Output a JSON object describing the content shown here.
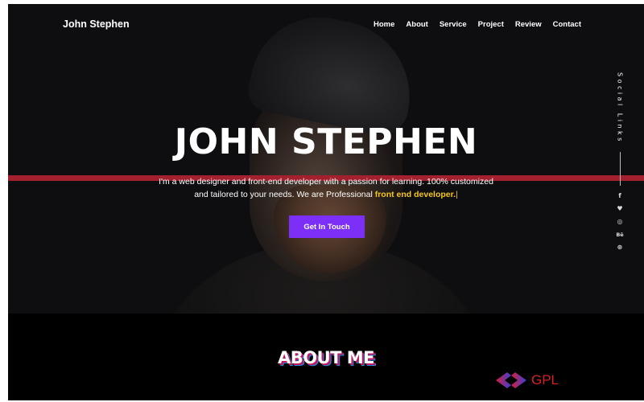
{
  "header": {
    "brand": "John Stephen",
    "nav": [
      {
        "label": "Home"
      },
      {
        "label": "About"
      },
      {
        "label": "Service"
      },
      {
        "label": "Project"
      },
      {
        "label": "Review"
      },
      {
        "label": "Contact"
      }
    ]
  },
  "hero": {
    "title": "JOHN STEPHEN",
    "description_line1": "I'm a web designer and front-end developer with a passion for learning. 100% customized",
    "description_line2": "and tailored to your needs. We are Professional",
    "highlight": "front end developer.",
    "cursor": "|",
    "cta_label": "Get In Touch"
  },
  "social": {
    "label": "Social Links",
    "icons": [
      {
        "name": "facebook-icon",
        "glyph": "f"
      },
      {
        "name": "twitter-icon",
        "glyph": "♥"
      },
      {
        "name": "instagram-icon",
        "glyph": "◎"
      },
      {
        "name": "behance-icon",
        "glyph": "Bē"
      },
      {
        "name": "dribbble-icon",
        "glyph": "⊛"
      }
    ]
  },
  "about": {
    "title": "ABOUT ME"
  },
  "watermark": {
    "text": "GPL"
  },
  "colors": {
    "accent": "#7b2ff7",
    "highlight": "#f5c518",
    "stripe": "#a3202f",
    "watermark": "#d51f26"
  }
}
